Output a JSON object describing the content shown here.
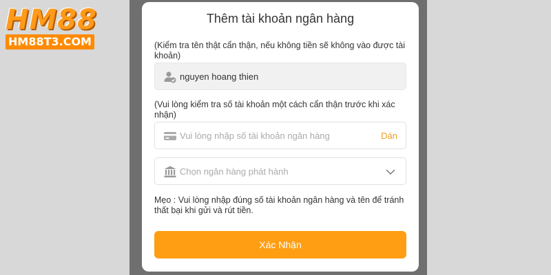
{
  "logo": {
    "main": "HM88",
    "sub": "HM88T3.COM"
  },
  "modal": {
    "title": "Thêm tài khoản ngân hàng",
    "name_note": "(Kiểm tra tên thật cẩn thận, nếu không tiền sẽ không vào được tài khoản)",
    "name_value": "nguyen hoang thien",
    "account_note": "(Vui lòng kiểm tra số tài khoản một cách cẩn thận trước khi xác nhận)",
    "account_placeholder": "Vui lòng nhập số tài khoản ngân hàng",
    "paste_label": "Dán",
    "bank_placeholder": "Chọn ngân hàng phát hành",
    "tip": "Mẹo :  Vui lòng nhập đúng số tài khoản ngân hàng và tên để tránh thất bại khi gửi và rút tiền.",
    "submit_label": "Xác Nhận"
  },
  "colors": {
    "accent": "#ff9e12",
    "paste": "#f0a020",
    "overlay": "#6f6f6f"
  },
  "icons": [
    "user-verified-icon",
    "card-icon",
    "bank-icon",
    "chevron-down-icon"
  ]
}
